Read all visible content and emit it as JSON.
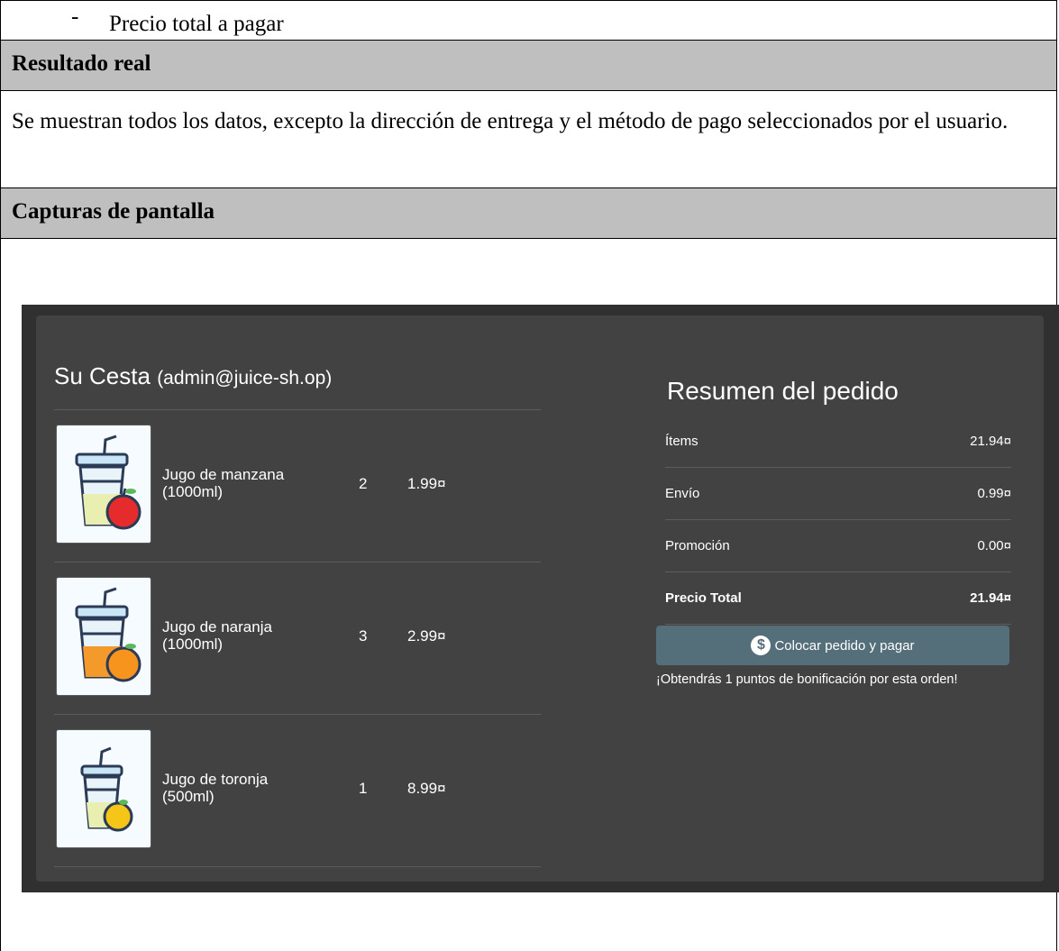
{
  "document": {
    "bullet_marker": "-",
    "bullet_text": "Precio total a pagar",
    "result_heading": "Resultado real",
    "result_text": "Se muestran todos los datos, excepto la dirección de entrega y el método de pago seleccionados por el usuario.",
    "screenshots_heading": "Capturas de pantalla"
  },
  "basket": {
    "title": "Su Cesta",
    "email": "(admin@juice-sh.op)",
    "items": [
      {
        "name": "Jugo de manzana (1000ml)",
        "quantity": "2",
        "price": "1.99¤",
        "icon": "apple-juice-icon"
      },
      {
        "name": "Jugo de naranja (1000ml)",
        "quantity": "3",
        "price": "2.99¤",
        "icon": "orange-juice-icon"
      },
      {
        "name": "Jugo de toronja (500ml)",
        "quantity": "1",
        "price": "8.99¤",
        "icon": "grapefruit-juice-icon"
      }
    ]
  },
  "summary": {
    "title": "Resumen del pedido",
    "rows": [
      {
        "label": "Ítems",
        "value": "21.94¤"
      },
      {
        "label": "Envío",
        "value": "0.99¤"
      },
      {
        "label": "Promoción",
        "value": "0.00¤"
      },
      {
        "label": "Precio Total",
        "value": "21.94¤"
      }
    ],
    "pay_button_label": "Colocar pedido y pagar",
    "pay_button_icon": "dollar-icon",
    "bonus_text": "¡Obtendrás 1 puntos de bonificación por esta orden!"
  },
  "colors": {
    "header_row": "#bfbfbf",
    "app_background": "#303030",
    "card_background": "#424242",
    "button": "#546e7a"
  }
}
